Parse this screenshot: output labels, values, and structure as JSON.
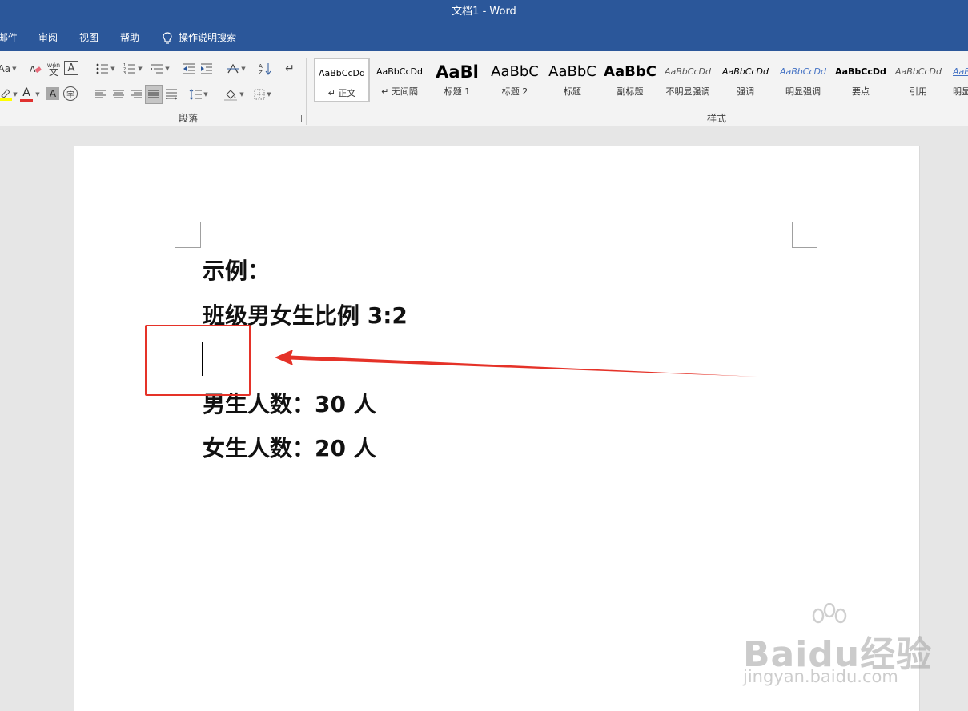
{
  "window": {
    "title": "文档1 - Word"
  },
  "menu": {
    "tabs": [
      "邮件",
      "审阅",
      "视图",
      "帮助"
    ],
    "search_label": "操作说明搜索"
  },
  "ribbon": {
    "font_group": {
      "font_size_button": "Aa",
      "wen_label": "wén",
      "wen_char": "文",
      "font_color_letter": "A",
      "char_border_letter": "A",
      "enclose_char": "字"
    },
    "paragraph_group": {
      "label": "段落"
    },
    "styles_group": {
      "label": "样式",
      "items": [
        {
          "sample": "AaBbCcDd",
          "name": "↵ 正文",
          "selected": true
        },
        {
          "sample": "AaBbCcDd",
          "name": "↵ 无间隔"
        },
        {
          "sample": "AaBl",
          "name": "标题 1"
        },
        {
          "sample": "AaBbC",
          "name": "标题 2"
        },
        {
          "sample": "AaBbC",
          "name": "标题"
        },
        {
          "sample": "AaBbC",
          "name": "副标题"
        },
        {
          "sample": "AaBbCcDd",
          "name": "不明显强调"
        },
        {
          "sample": "AaBbCcDd",
          "name": "强调"
        },
        {
          "sample": "AaBbCcDd",
          "name": "明显强调"
        },
        {
          "sample": "AaBbCcDd",
          "name": "要点"
        },
        {
          "sample": "AaBbCcDd",
          "name": "引用"
        },
        {
          "sample": "AaBl",
          "name": "明显"
        }
      ]
    }
  },
  "document": {
    "lines": [
      "示例：",
      "班级男女生比例  3:2",
      "男生人数：30 人",
      "女生人数：20 人"
    ]
  },
  "watermark": {
    "brand": "Baidu经验",
    "url": "jingyan.baidu.com"
  },
  "colors": {
    "accent": "#2b579a",
    "annotation": "#e53228",
    "font_color_bar": "#e0312f",
    "highlight_bar": "#ffff00"
  }
}
